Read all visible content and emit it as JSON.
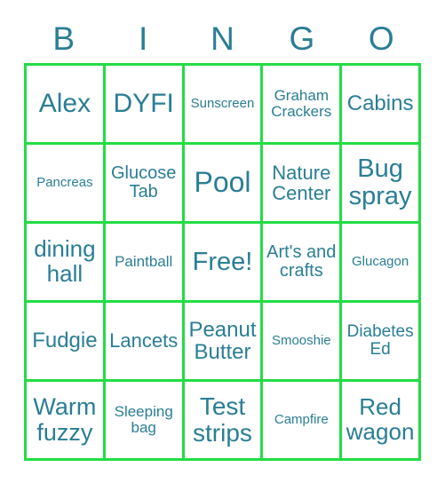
{
  "card": {
    "title_letters": [
      "B",
      "I",
      "N",
      "G",
      "O"
    ],
    "accent_grid_color": "#22dd44",
    "text_color": "#2a7e95",
    "background_color": "#ffffff",
    "columns": 5,
    "rows": 5
  },
  "cells": [
    {
      "text": "Alex",
      "font_size": 30,
      "row": 1,
      "col": 1
    },
    {
      "text": "DYFI",
      "font_size": 30,
      "row": 1,
      "col": 2
    },
    {
      "text": "Sunscreen",
      "font_size": 15,
      "row": 1,
      "col": 3
    },
    {
      "text": "Graham Crackers",
      "font_size": 17,
      "row": 1,
      "col": 4
    },
    {
      "text": "Cabins",
      "font_size": 24,
      "row": 1,
      "col": 5
    },
    {
      "text": "Pancreas",
      "font_size": 15,
      "row": 2,
      "col": 1
    },
    {
      "text": "Glucose Tab",
      "font_size": 20,
      "row": 2,
      "col": 2
    },
    {
      "text": "Pool",
      "font_size": 32,
      "row": 2,
      "col": 3
    },
    {
      "text": "Nature Center",
      "font_size": 22,
      "row": 2,
      "col": 4
    },
    {
      "text": "Bug spray",
      "font_size": 29,
      "row": 2,
      "col": 5
    },
    {
      "text": "dining hall",
      "font_size": 26,
      "row": 3,
      "col": 1
    },
    {
      "text": "Paintball",
      "font_size": 17,
      "row": 3,
      "col": 2
    },
    {
      "text": "Free!",
      "font_size": 29,
      "row": 3,
      "col": 3
    },
    {
      "text": "Art's and crafts",
      "font_size": 20,
      "row": 3,
      "col": 4
    },
    {
      "text": "Glucagon",
      "font_size": 15,
      "row": 3,
      "col": 5
    },
    {
      "text": "Fudgie",
      "font_size": 24,
      "row": 4,
      "col": 1
    },
    {
      "text": "Lancets",
      "font_size": 22,
      "row": 4,
      "col": 2
    },
    {
      "text": "Peanut Butter",
      "font_size": 24,
      "row": 4,
      "col": 3
    },
    {
      "text": "Smooshie",
      "font_size": 15,
      "row": 4,
      "col": 4
    },
    {
      "text": "Diabetes Ed",
      "font_size": 19,
      "row": 4,
      "col": 5
    },
    {
      "text": "Warm fuzzy",
      "font_size": 27,
      "row": 5,
      "col": 1
    },
    {
      "text": "Sleeping bag",
      "font_size": 17,
      "row": 5,
      "col": 2
    },
    {
      "text": "Test strips",
      "font_size": 28,
      "row": 5,
      "col": 3
    },
    {
      "text": "Campfire",
      "font_size": 15,
      "row": 5,
      "col": 4
    },
    {
      "text": "Red wagon",
      "font_size": 26,
      "row": 5,
      "col": 5
    }
  ]
}
